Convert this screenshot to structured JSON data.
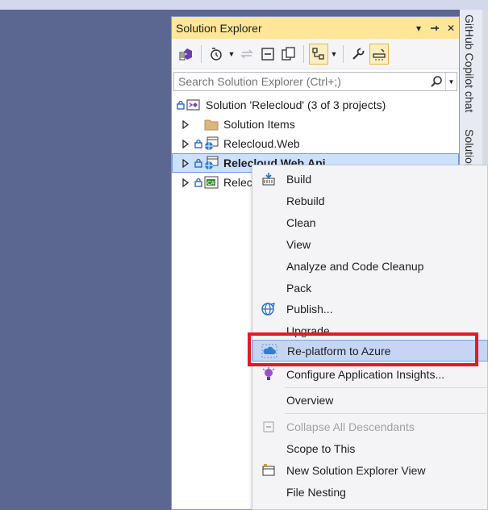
{
  "panel": {
    "title": "Solution Explorer",
    "title_buttons": {
      "dropdown": "▾",
      "pin": "⊣",
      "close": "✕"
    },
    "search_placeholder": "Search Solution Explorer (Ctrl+;)"
  },
  "side_tabs": {
    "copilot": "GitHub Copilot chat",
    "solution": "Solution"
  },
  "tree": {
    "solution": "Solution 'Relecloud' (3 of 3 projects)",
    "items": [
      {
        "label": "Solution Items",
        "icon": "folder-icon"
      },
      {
        "label": "Relecloud.Web",
        "icon": "web-project-icon"
      },
      {
        "label": "Relecloud.Web.Api",
        "icon": "web-project-icon",
        "selected": true
      },
      {
        "label": "Relec",
        "icon": "csharp-project-icon"
      }
    ]
  },
  "menu": {
    "build": "Build",
    "rebuild": "Rebuild",
    "clean": "Clean",
    "view": "View",
    "analyze": "Analyze and Code Cleanup",
    "pack": "Pack",
    "publish": "Publish...",
    "upgrade": "Upgrade",
    "replatform": "Re-platform to Azure",
    "app_insights": "Configure Application Insights...",
    "overview": "Overview",
    "collapse": "Collapse All Descendants",
    "scope": "Scope to This",
    "new_view": "New Solution Explorer View",
    "file_nesting": "File Nesting"
  },
  "colors": {
    "title_bar": "#ffe699",
    "selection": "#cce0ff",
    "menu_highlight": "#c6d5f3",
    "annotation_outline": "#e01b24",
    "background": "#5b6790"
  }
}
